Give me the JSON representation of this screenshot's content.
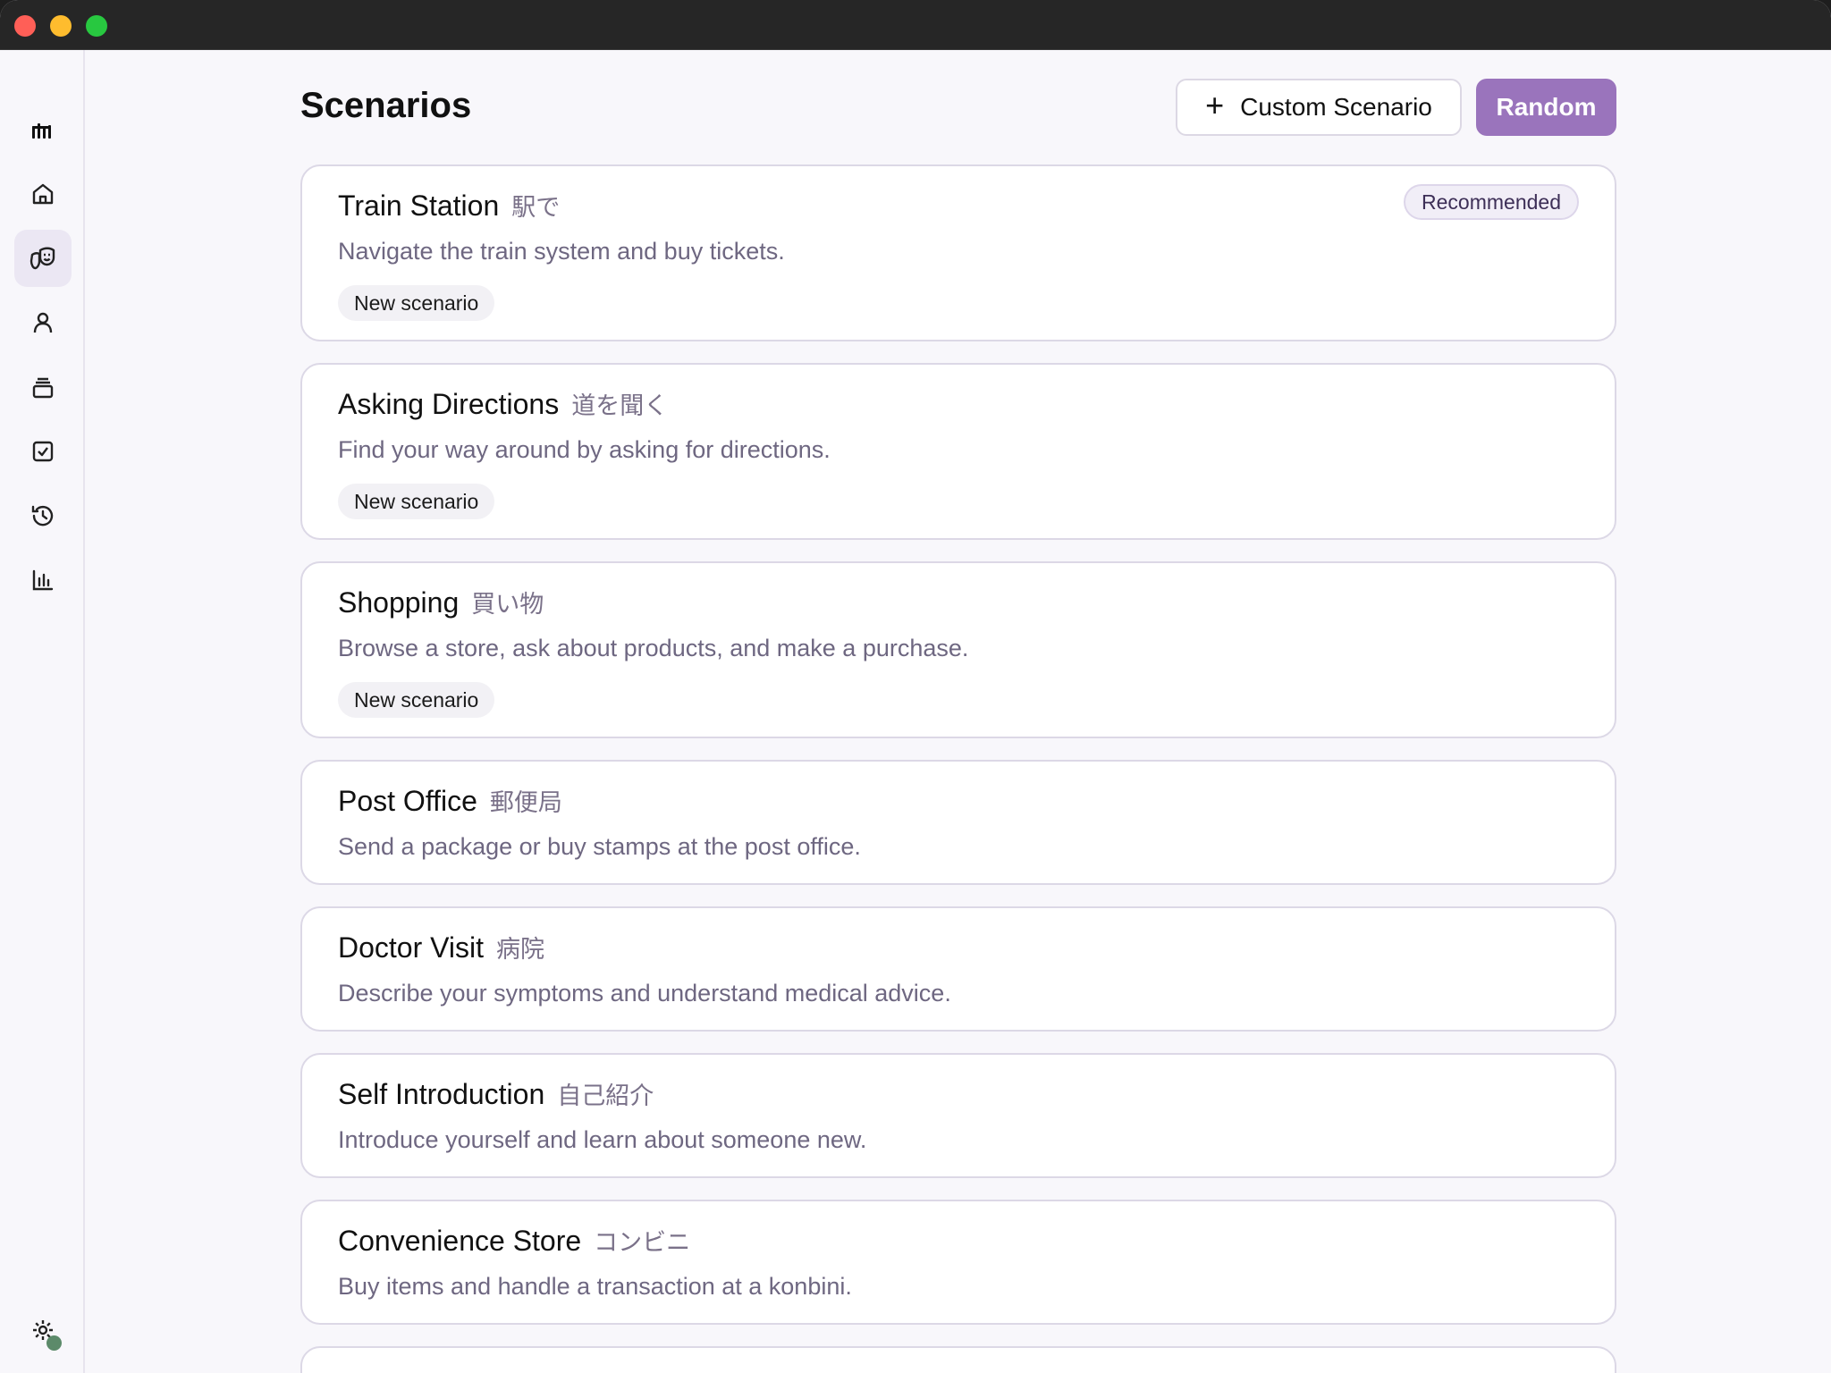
{
  "page": {
    "title": "Scenarios",
    "custom_button_label": "Custom Scenario",
    "random_button_label": "Random"
  },
  "sidebar": {
    "items": [
      {
        "name": "logo",
        "icon": "logo-icon"
      },
      {
        "name": "home",
        "icon": "home-icon"
      },
      {
        "name": "scenarios",
        "icon": "theater-masks-icon",
        "active": true
      },
      {
        "name": "characters",
        "icon": "person-icon"
      },
      {
        "name": "decks",
        "icon": "stack-icon"
      },
      {
        "name": "tasks",
        "icon": "checkbox-icon"
      },
      {
        "name": "history",
        "icon": "history-icon"
      },
      {
        "name": "stats",
        "icon": "bar-chart-icon"
      },
      {
        "name": "settings",
        "icon": "gear-icon"
      }
    ]
  },
  "scenarios": [
    {
      "title": "Train Station",
      "jp": "駅で",
      "desc": "Navigate the train system and buy tickets.",
      "tag": "New scenario",
      "badge": "Recommended"
    },
    {
      "title": "Asking Directions",
      "jp": "道を聞く",
      "desc": "Find your way around by asking for directions.",
      "tag": "New scenario"
    },
    {
      "title": "Shopping",
      "jp": "買い物",
      "desc": "Browse a store, ask about products, and make a purchase.",
      "tag": "New scenario"
    },
    {
      "title": "Post Office",
      "jp": "郵便局",
      "desc": "Send a package or buy stamps at the post office."
    },
    {
      "title": "Doctor Visit",
      "jp": "病院",
      "desc": "Describe your symptoms and understand medical advice."
    },
    {
      "title": "Self Introduction",
      "jp": "自己紹介",
      "desc": "Introduce yourself and learn about someone new."
    },
    {
      "title": "Convenience Store",
      "jp": "コンビニ",
      "desc": "Buy items and handle a transaction at a konbini."
    }
  ],
  "colors": {
    "accent": "#9a74bc",
    "background": "#f8f7fb",
    "card_border": "#dcd8e6",
    "status_dot": "#5c8a6a"
  }
}
